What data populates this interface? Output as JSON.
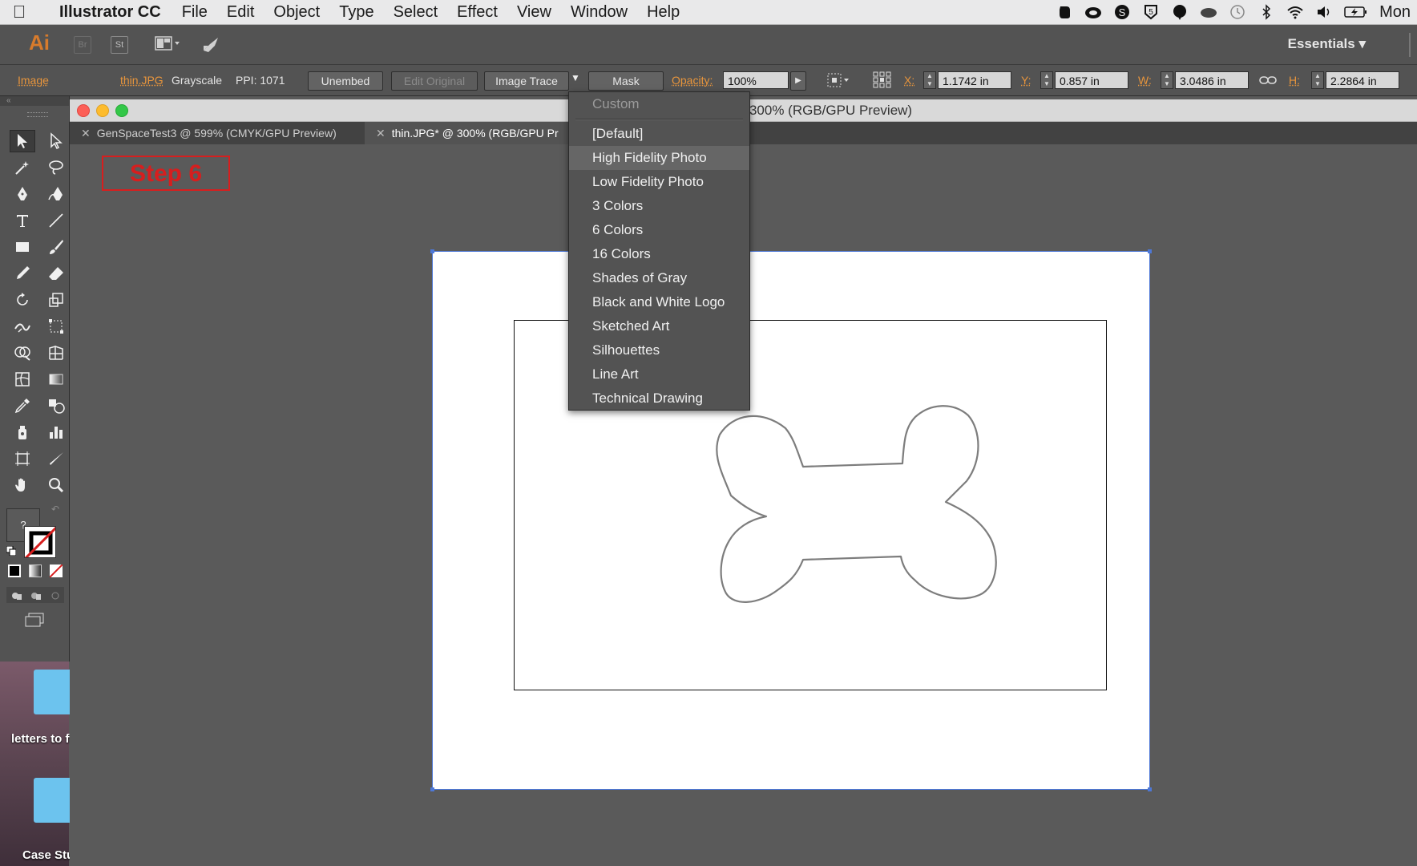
{
  "menubar": {
    "app_name": "Illustrator CC",
    "items": [
      "File",
      "Edit",
      "Object",
      "Type",
      "Select",
      "Effect",
      "View",
      "Window",
      "Help"
    ],
    "clock": "Mon"
  },
  "appbar": {
    "logo": "Ai",
    "bridge": "Br",
    "stock": "St",
    "workspace": "Essentials"
  },
  "control": {
    "object_type": "Image",
    "file_name": "thin.JPG",
    "color_mode": "Grayscale",
    "ppi": "PPI: 1071",
    "unembed": "Unembed",
    "edit_original": "Edit Original",
    "image_trace": "Image Trace",
    "mask": "Mask",
    "opacity_label": "Opacity:",
    "opacity_value": "100%",
    "x_label": "X:",
    "x_value": "1.1742 in",
    "y_label": "Y:",
    "y_value": "0.857 in",
    "w_label": "W:",
    "w_value": "3.0486 in",
    "h_label": "H:",
    "h_value": "2.2864 in"
  },
  "document": {
    "window_title": "@ 300% (RGB/GPU Preview)",
    "tabs": [
      {
        "label": "GenSpaceTest3 @ 599% (CMYK/GPU Preview)"
      },
      {
        "label": "thin.JPG* @ 300% (RGB/GPU Pr"
      }
    ]
  },
  "annotation": {
    "step": "Step 6"
  },
  "preset_menu": {
    "header": "Custom",
    "options": [
      "[Default]",
      "High Fidelity Photo",
      "Low Fidelity Photo",
      "3 Colors",
      "6 Colors",
      "16 Colors",
      "Shades of Gray",
      "Black and White Logo",
      "Sketched Art",
      "Silhouettes",
      "Line Art",
      "Technical Drawing"
    ],
    "highlighted": "High Fidelity Photo"
  },
  "desktop": {
    "items": [
      "letters to f",
      "Case Stu"
    ]
  },
  "colors": {
    "accent_orange": "#e8953c",
    "selection_blue": "#4e78d6",
    "step_red": "#d71e1e"
  }
}
